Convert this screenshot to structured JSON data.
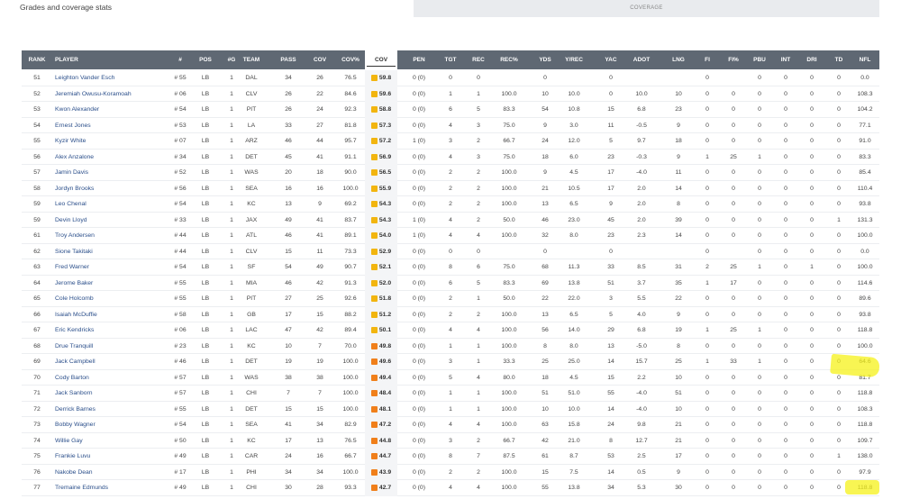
{
  "page": {
    "title": "Grades and coverage stats"
  },
  "colors": {
    "header_bg": "#5f6873",
    "grade_yellow": "#f2b50f",
    "grade_orange": "#f07f1a",
    "highlight": "#f6f21a"
  },
  "table": {
    "group_header": "COVERAGE",
    "active_sort": "COV",
    "columns": [
      "RANK",
      "PLAYER",
      "#",
      "POS",
      "#G",
      "TEAM",
      "PASS",
      "COV",
      "COV%",
      "COV",
      "PEN",
      "TGT",
      "REC",
      "REC%",
      "YDS",
      "Y/REC",
      "YAC",
      "ADOT",
      "LNG",
      "FI",
      "FI%",
      "PBU",
      "INT",
      "DRI",
      "TD",
      "NFL"
    ],
    "rows": [
      [
        "51",
        "Leighton Vander Esch",
        "# 55",
        "LB",
        "1",
        "DAL",
        "34",
        "26",
        "76.5",
        "59.8",
        "0 (0)",
        "0",
        "0",
        "",
        "0",
        "",
        "0",
        "",
        "",
        "0",
        "",
        "0",
        "0",
        "0",
        "0",
        "0.0"
      ],
      [
        "52",
        "Jeremiah Owusu-Koramoah",
        "# 06",
        "LB",
        "1",
        "CLV",
        "26",
        "22",
        "84.6",
        "59.6",
        "0 (0)",
        "1",
        "1",
        "100.0",
        "10",
        "10.0",
        "0",
        "10.0",
        "10",
        "0",
        "0",
        "0",
        "0",
        "0",
        "0",
        "108.3"
      ],
      [
        "53",
        "Kwon Alexander",
        "# 54",
        "LB",
        "1",
        "PIT",
        "26",
        "24",
        "92.3",
        "58.8",
        "0 (0)",
        "6",
        "5",
        "83.3",
        "54",
        "10.8",
        "15",
        "6.8",
        "23",
        "0",
        "0",
        "0",
        "0",
        "0",
        "0",
        "104.2"
      ],
      [
        "54",
        "Ernest Jones",
        "# 53",
        "LB",
        "1",
        "LA",
        "33",
        "27",
        "81.8",
        "57.3",
        "0 (0)",
        "4",
        "3",
        "75.0",
        "9",
        "3.0",
        "11",
        "-0.5",
        "9",
        "0",
        "0",
        "0",
        "0",
        "0",
        "0",
        "77.1"
      ],
      [
        "55",
        "Kyzir White",
        "# 07",
        "LB",
        "1",
        "ARZ",
        "46",
        "44",
        "95.7",
        "57.2",
        "1 (0)",
        "3",
        "2",
        "66.7",
        "24",
        "12.0",
        "5",
        "9.7",
        "18",
        "0",
        "0",
        "0",
        "0",
        "0",
        "0",
        "91.0"
      ],
      [
        "56",
        "Alex Anzalone",
        "# 34",
        "LB",
        "1",
        "DET",
        "45",
        "41",
        "91.1",
        "56.9",
        "0 (0)",
        "4",
        "3",
        "75.0",
        "18",
        "6.0",
        "23",
        "-0.3",
        "9",
        "1",
        "25",
        "1",
        "0",
        "0",
        "0",
        "83.3"
      ],
      [
        "57",
        "Jamin Davis",
        "# 52",
        "LB",
        "1",
        "WAS",
        "20",
        "18",
        "90.0",
        "56.5",
        "0 (0)",
        "2",
        "2",
        "100.0",
        "9",
        "4.5",
        "17",
        "-4.0",
        "11",
        "0",
        "0",
        "0",
        "0",
        "0",
        "0",
        "85.4"
      ],
      [
        "58",
        "Jordyn Brooks",
        "# 56",
        "LB",
        "1",
        "SEA",
        "16",
        "16",
        "100.0",
        "55.9",
        "0 (0)",
        "2",
        "2",
        "100.0",
        "21",
        "10.5",
        "17",
        "2.0",
        "14",
        "0",
        "0",
        "0",
        "0",
        "0",
        "0",
        "110.4"
      ],
      [
        "59",
        "Leo Chenal",
        "# 54",
        "LB",
        "1",
        "KC",
        "13",
        "9",
        "69.2",
        "54.3",
        "0 (0)",
        "2",
        "2",
        "100.0",
        "13",
        "6.5",
        "9",
        "2.0",
        "8",
        "0",
        "0",
        "0",
        "0",
        "0",
        "0",
        "93.8"
      ],
      [
        "59",
        "Devin Lloyd",
        "# 33",
        "LB",
        "1",
        "JAX",
        "49",
        "41",
        "83.7",
        "54.3",
        "1 (0)",
        "4",
        "2",
        "50.0",
        "46",
        "23.0",
        "45",
        "2.0",
        "39",
        "0",
        "0",
        "0",
        "0",
        "0",
        "1",
        "131.3"
      ],
      [
        "61",
        "Troy Andersen",
        "# 44",
        "LB",
        "1",
        "ATL",
        "46",
        "41",
        "89.1",
        "54.0",
        "1 (0)",
        "4",
        "4",
        "100.0",
        "32",
        "8.0",
        "23",
        "2.3",
        "14",
        "0",
        "0",
        "0",
        "0",
        "0",
        "0",
        "100.0"
      ],
      [
        "62",
        "Sione Takitaki",
        "# 44",
        "LB",
        "1",
        "CLV",
        "15",
        "11",
        "73.3",
        "52.9",
        "0 (0)",
        "0",
        "0",
        "",
        "0",
        "",
        "0",
        "",
        "",
        "0",
        "",
        "0",
        "0",
        "0",
        "0",
        "0.0"
      ],
      [
        "63",
        "Fred Warner",
        "# 54",
        "LB",
        "1",
        "SF",
        "54",
        "49",
        "90.7",
        "52.1",
        "0 (0)",
        "8",
        "6",
        "75.0",
        "68",
        "11.3",
        "33",
        "8.5",
        "31",
        "2",
        "25",
        "1",
        "0",
        "1",
        "0",
        "100.0"
      ],
      [
        "64",
        "Jerome Baker",
        "# 55",
        "LB",
        "1",
        "MIA",
        "46",
        "42",
        "91.3",
        "52.0",
        "0 (0)",
        "6",
        "5",
        "83.3",
        "69",
        "13.8",
        "51",
        "3.7",
        "35",
        "1",
        "17",
        "0",
        "0",
        "0",
        "0",
        "114.6"
      ],
      [
        "65",
        "Cole Holcomb",
        "# 55",
        "LB",
        "1",
        "PIT",
        "27",
        "25",
        "92.6",
        "51.8",
        "0 (0)",
        "2",
        "1",
        "50.0",
        "22",
        "22.0",
        "3",
        "5.5",
        "22",
        "0",
        "0",
        "0",
        "0",
        "0",
        "0",
        "89.6"
      ],
      [
        "66",
        "Isaiah McDuffie",
        "# 58",
        "LB",
        "1",
        "GB",
        "17",
        "15",
        "88.2",
        "51.2",
        "0 (0)",
        "2",
        "2",
        "100.0",
        "13",
        "6.5",
        "5",
        "4.0",
        "9",
        "0",
        "0",
        "0",
        "0",
        "0",
        "0",
        "93.8"
      ],
      [
        "67",
        "Eric Kendricks",
        "# 06",
        "LB",
        "1",
        "LAC",
        "47",
        "42",
        "89.4",
        "50.1",
        "0 (0)",
        "4",
        "4",
        "100.0",
        "56",
        "14.0",
        "29",
        "6.8",
        "19",
        "1",
        "25",
        "1",
        "0",
        "0",
        "0",
        "118.8"
      ],
      [
        "68",
        "Drue Tranquill",
        "# 23",
        "LB",
        "1",
        "KC",
        "10",
        "7",
        "70.0",
        "49.8",
        "0 (0)",
        "1",
        "1",
        "100.0",
        "8",
        "8.0",
        "13",
        "-5.0",
        "8",
        "0",
        "0",
        "0",
        "0",
        "0",
        "0",
        "100.0"
      ],
      [
        "69",
        "Jack Campbell",
        "# 46",
        "LB",
        "1",
        "DET",
        "19",
        "19",
        "100.0",
        "49.6",
        "0 (0)",
        "3",
        "1",
        "33.3",
        "25",
        "25.0",
        "14",
        "15.7",
        "25",
        "1",
        "33",
        "1",
        "0",
        "0",
        "0",
        "64.6"
      ],
      [
        "70",
        "Cody Barton",
        "# 57",
        "LB",
        "1",
        "WAS",
        "38",
        "38",
        "100.0",
        "49.4",
        "0 (0)",
        "5",
        "4",
        "80.0",
        "18",
        "4.5",
        "15",
        "2.2",
        "10",
        "0",
        "0",
        "0",
        "0",
        "0",
        "0",
        "81.7"
      ],
      [
        "71",
        "Jack Sanborn",
        "# 57",
        "LB",
        "1",
        "CHI",
        "7",
        "7",
        "100.0",
        "48.4",
        "0 (0)",
        "1",
        "1",
        "100.0",
        "51",
        "51.0",
        "55",
        "-4.0",
        "51",
        "0",
        "0",
        "0",
        "0",
        "0",
        "0",
        "118.8"
      ],
      [
        "72",
        "Derrick Barnes",
        "# 55",
        "LB",
        "1",
        "DET",
        "15",
        "15",
        "100.0",
        "48.1",
        "0 (0)",
        "1",
        "1",
        "100.0",
        "10",
        "10.0",
        "14",
        "-4.0",
        "10",
        "0",
        "0",
        "0",
        "0",
        "0",
        "0",
        "108.3"
      ],
      [
        "73",
        "Bobby Wagner",
        "# 54",
        "LB",
        "1",
        "SEA",
        "41",
        "34",
        "82.9",
        "47.2",
        "0 (0)",
        "4",
        "4",
        "100.0",
        "63",
        "15.8",
        "24",
        "9.8",
        "21",
        "0",
        "0",
        "0",
        "0",
        "0",
        "0",
        "118.8"
      ],
      [
        "74",
        "Willie Gay",
        "# 50",
        "LB",
        "1",
        "KC",
        "17",
        "13",
        "76.5",
        "44.8",
        "0 (0)",
        "3",
        "2",
        "66.7",
        "42",
        "21.0",
        "8",
        "12.7",
        "21",
        "0",
        "0",
        "0",
        "0",
        "0",
        "0",
        "109.7"
      ],
      [
        "75",
        "Frankie Luvu",
        "# 49",
        "LB",
        "1",
        "CAR",
        "24",
        "16",
        "66.7",
        "44.7",
        "0 (0)",
        "8",
        "7",
        "87.5",
        "61",
        "8.7",
        "53",
        "2.5",
        "17",
        "0",
        "0",
        "0",
        "0",
        "0",
        "1",
        "138.0"
      ],
      [
        "76",
        "Nakobe Dean",
        "# 17",
        "LB",
        "1",
        "PHI",
        "34",
        "34",
        "100.0",
        "43.9",
        "0 (0)",
        "2",
        "2",
        "100.0",
        "15",
        "7.5",
        "14",
        "0.5",
        "9",
        "0",
        "0",
        "0",
        "0",
        "0",
        "0",
        "97.9"
      ],
      [
        "77",
        "Tremaine Edmunds",
        "# 49",
        "LB",
        "1",
        "CHI",
        "30",
        "28",
        "93.3",
        "42.7",
        "0 (0)",
        "4",
        "4",
        "100.0",
        "55",
        "13.8",
        "34",
        "5.3",
        "30",
        "0",
        "0",
        "0",
        "0",
        "0",
        "0",
        "118.8"
      ]
    ]
  }
}
